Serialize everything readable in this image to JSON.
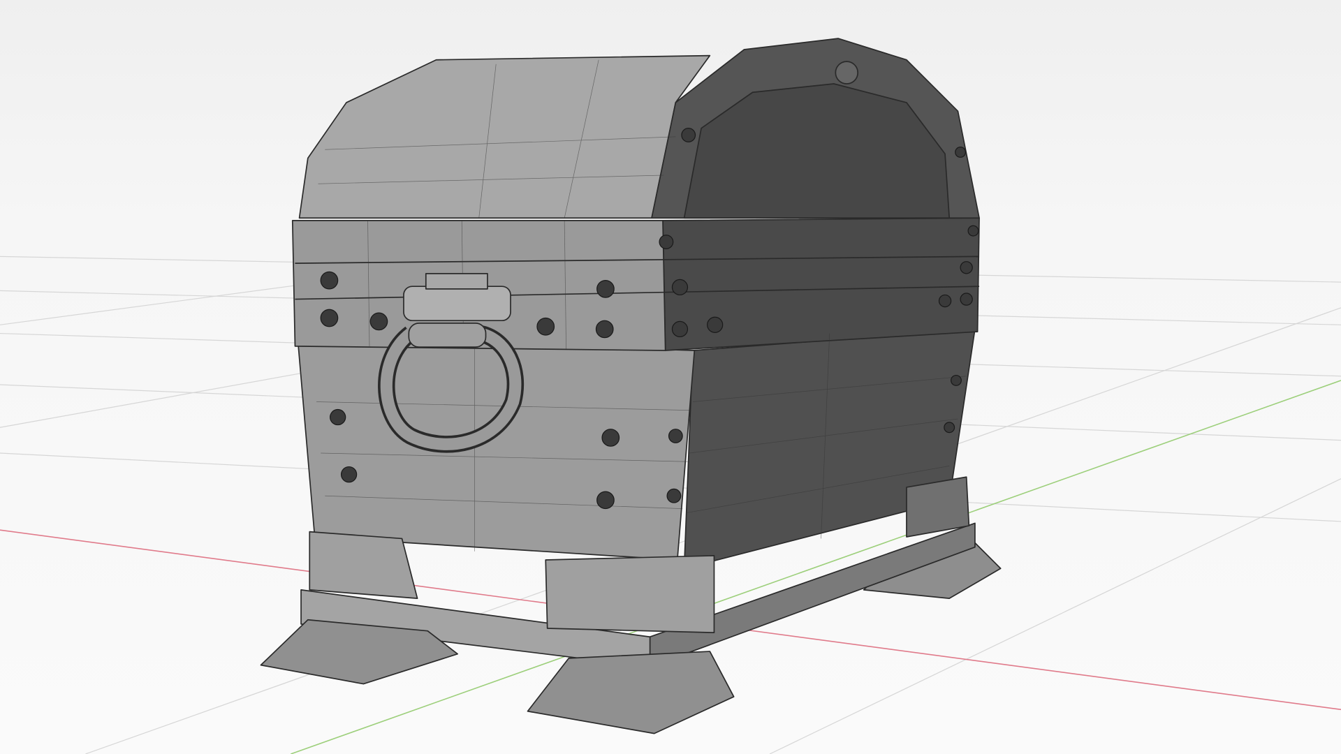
{
  "scene": {
    "subject": "treasure-chest-wireframe",
    "colors": {
      "background": "#f2f2f2",
      "lit_face": "#a6a6a6",
      "mid_face": "#8e8e8e",
      "dark_face": "#4e4e4e",
      "x_axis": "#e07a8a",
      "y_axis": "#9ccf7a"
    }
  }
}
